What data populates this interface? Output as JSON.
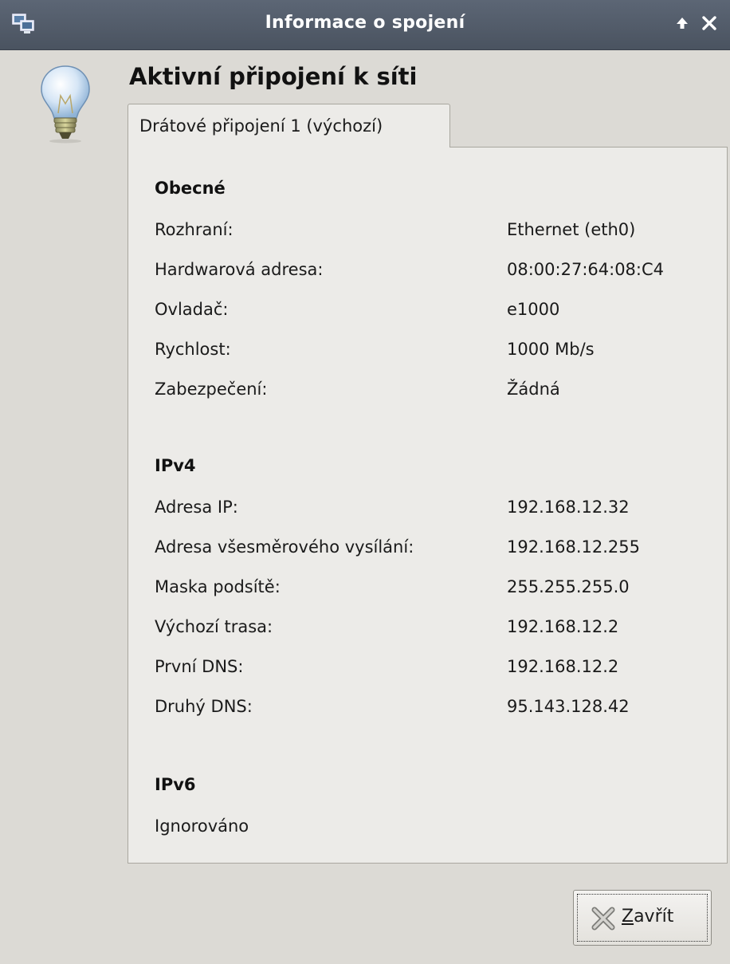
{
  "window": {
    "title": "Informace o spojení"
  },
  "heading": "Aktivní připojení k síti",
  "tab": {
    "label": "Drátové připojení 1 (výchozí)"
  },
  "general": {
    "title": "Obecné",
    "rows": [
      {
        "label": "Rozhraní:",
        "value": "Ethernet (eth0)"
      },
      {
        "label": "Hardwarová adresa:",
        "value": "08:00:27:64:08:C4"
      },
      {
        "label": "Ovladač:",
        "value": "e1000"
      },
      {
        "label": "Rychlost:",
        "value": "1000 Mb/s"
      },
      {
        "label": "Zabezpečení:",
        "value": "Žádná"
      }
    ]
  },
  "ipv4": {
    "title": "IPv4",
    "rows": [
      {
        "label": "Adresa IP:",
        "value": "192.168.12.32"
      },
      {
        "label": "Adresa všesměrového vysílání:",
        "value": "192.168.12.255"
      },
      {
        "label": "Maska podsítě:",
        "value": "255.255.255.0"
      },
      {
        "label": "Výchozí trasa:",
        "value": "192.168.12.2"
      },
      {
        "label": "První DNS:",
        "value": "192.168.12.2"
      },
      {
        "label": "Druhý DNS:",
        "value": "95.143.128.42"
      }
    ]
  },
  "ipv6": {
    "title": "IPv6",
    "status": "Ignorováno"
  },
  "close_button": {
    "mnemonic": "Z",
    "label_rest": "avřít"
  },
  "icons": {
    "titlebar": "network-computer-icon",
    "header": "lightbulb-icon",
    "close": "close-x-icon"
  },
  "colors": {
    "titlebar": "#4f5865",
    "background": "#dcdad5",
    "panel": "#ecebe8"
  }
}
